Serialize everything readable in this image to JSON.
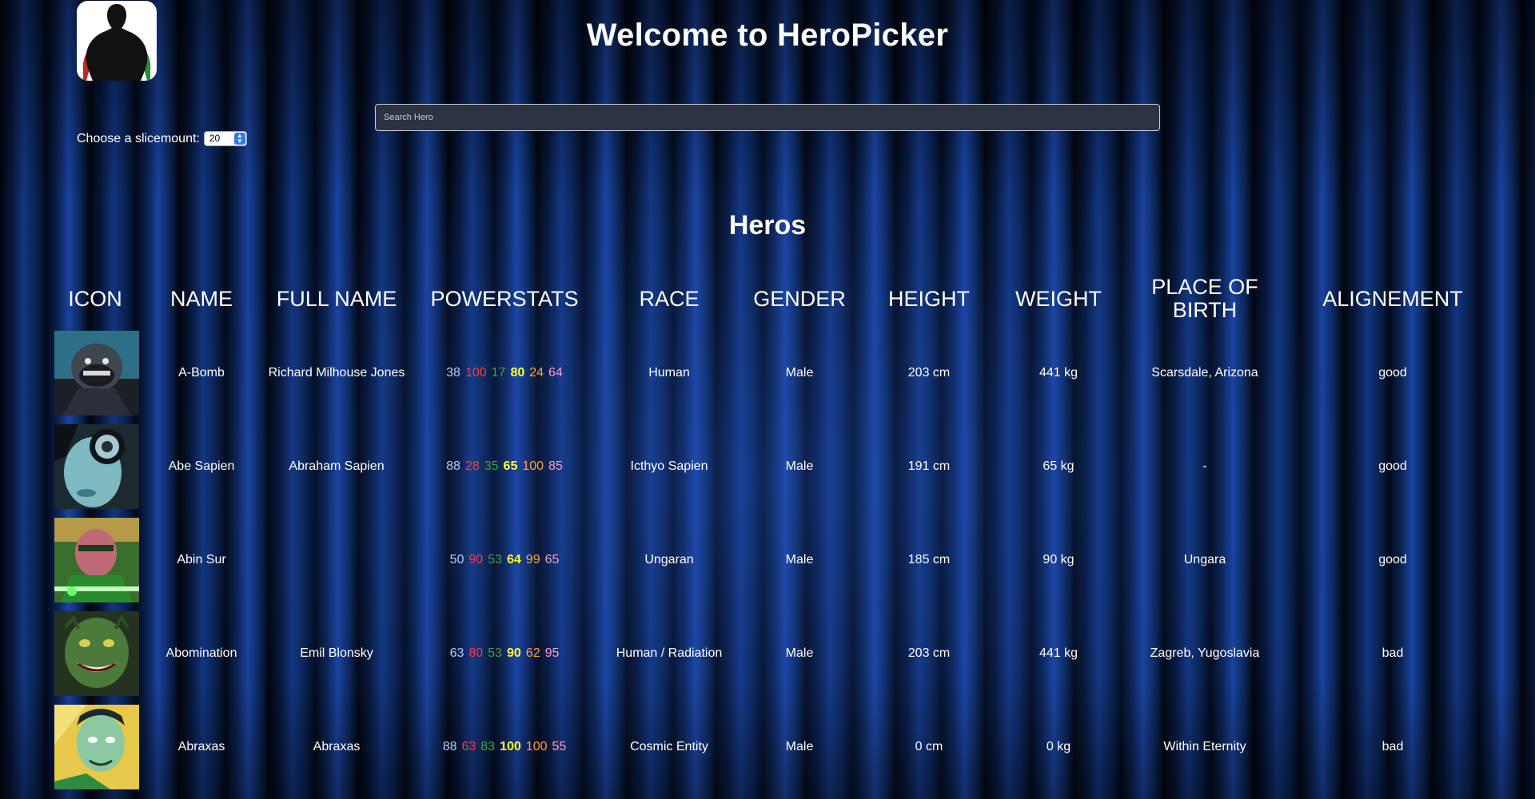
{
  "header": {
    "title": "Welcome to HeroPicker"
  },
  "slice": {
    "label": "Choose a slicemount:",
    "value": "20"
  },
  "search": {
    "placeholder": "Search Hero"
  },
  "section": {
    "title": "Heros"
  },
  "table": {
    "columns": [
      "ICON",
      "NAME",
      "FULL NAME",
      "POWERSTATS",
      "RACE",
      "GENDER",
      "HEIGHT",
      "WEIGHT",
      "PLACE OF BIRTH",
      "ALIGNEMENT"
    ],
    "stat_colors": [
      "#b7cdf3",
      "#ff3a3a",
      "#3fa33f",
      "#ffff33",
      "#ffa63a",
      "#ff9fc3"
    ],
    "rows": [
      {
        "name": "A-Bomb",
        "full_name": "Richard Milhouse Jones",
        "powerstats": [
          "38",
          "100",
          "17",
          "80",
          "24",
          "64"
        ],
        "race": "Human",
        "gender": "Male",
        "height": "203 cm",
        "weight": "441 kg",
        "place_of_birth": "Scarsdale, Arizona",
        "alignment": "good",
        "icon": "a-bomb-portrait-icon"
      },
      {
        "name": "Abe Sapien",
        "full_name": "Abraham Sapien",
        "powerstats": [
          "88",
          "28",
          "35",
          "65",
          "100",
          "85"
        ],
        "race": "Icthyo Sapien",
        "gender": "Male",
        "height": "191 cm",
        "weight": "65 kg",
        "place_of_birth": "-",
        "alignment": "good",
        "icon": "abe-sapien-portrait-icon"
      },
      {
        "name": "Abin Sur",
        "full_name": "",
        "powerstats": [
          "50",
          "90",
          "53",
          "64",
          "99",
          "65"
        ],
        "race": "Ungaran",
        "gender": "Male",
        "height": "185 cm",
        "weight": "90 kg",
        "place_of_birth": "Ungara",
        "alignment": "good",
        "icon": "abin-sur-portrait-icon"
      },
      {
        "name": "Abomination",
        "full_name": "Emil Blonsky",
        "powerstats": [
          "63",
          "80",
          "53",
          "90",
          "62",
          "95"
        ],
        "race": "Human / Radiation",
        "gender": "Male",
        "height": "203 cm",
        "weight": "441 kg",
        "place_of_birth": "Zagreb, Yugoslavia",
        "alignment": "bad",
        "icon": "abomination-portrait-icon"
      },
      {
        "name": "Abraxas",
        "full_name": "Abraxas",
        "powerstats": [
          "88",
          "63",
          "83",
          "100",
          "100",
          "55"
        ],
        "race": "Cosmic Entity",
        "gender": "Male",
        "height": "0 cm",
        "weight": "0 kg",
        "place_of_birth": "Within Eternity",
        "alignment": "bad",
        "icon": "abraxas-portrait-icon"
      }
    ]
  }
}
